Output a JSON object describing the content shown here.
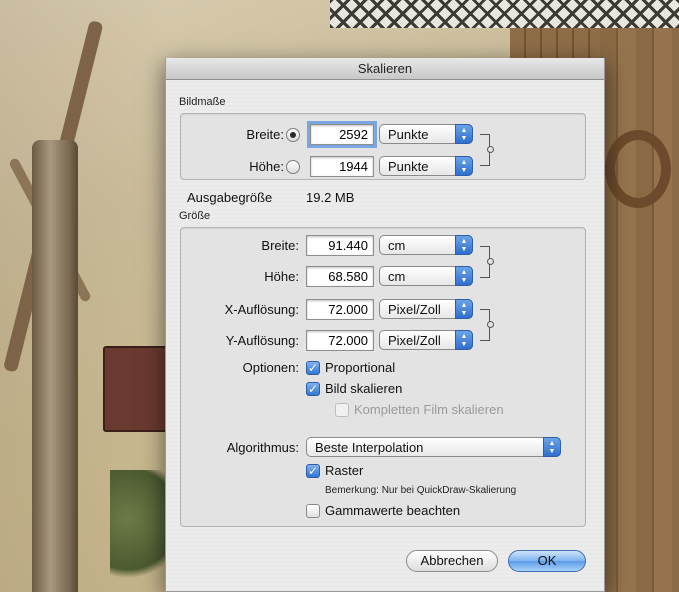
{
  "dialog": {
    "title": "Skalieren",
    "bildmasse": {
      "section_label": "Bildmaße",
      "breite_label": "Breite:",
      "breite_value": "2592",
      "breite_unit": "Punkte",
      "hoehe_label": "Höhe:",
      "hoehe_value": "1944",
      "hoehe_unit": "Punkte",
      "selected_radio": "breite",
      "ausgabe_label": "Ausgabegröße",
      "ausgabe_value": "19.2 MB"
    },
    "groesse": {
      "section_label": "Größe",
      "breite_label": "Breite:",
      "breite_value": "91.440",
      "breite_unit": "cm",
      "hoehe_label": "Höhe:",
      "hoehe_value": "68.580",
      "hoehe_unit": "cm",
      "xres_label": "X-Auflösung:",
      "xres_value": "72.000",
      "xres_unit": "Pixel/Zoll",
      "yres_label": "Y-Auflösung:",
      "yres_value": "72.000",
      "yres_unit": "Pixel/Zoll",
      "optionen_label": "Optionen:",
      "proportional_label": "Proportional",
      "proportional_checked": true,
      "bild_skalieren_label": "Bild skalieren",
      "bild_skalieren_checked": true,
      "film_label": "Kompletten Film skalieren",
      "film_checked": false,
      "film_enabled": false,
      "algorithmus_label": "Algorithmus:",
      "algorithmus_value": "Beste Interpolation",
      "raster_label": "Raster",
      "raster_checked": true,
      "bemerkung": "Bemerkung: Nur bei QuickDraw-Skalierung",
      "gamma_label": "Gammawerte beachten",
      "gamma_checked": false
    },
    "buttons": {
      "cancel": "Abbrechen",
      "ok": "OK"
    }
  },
  "colors": {
    "accent": "#3577d6",
    "dialog_bg": "#ececec"
  }
}
